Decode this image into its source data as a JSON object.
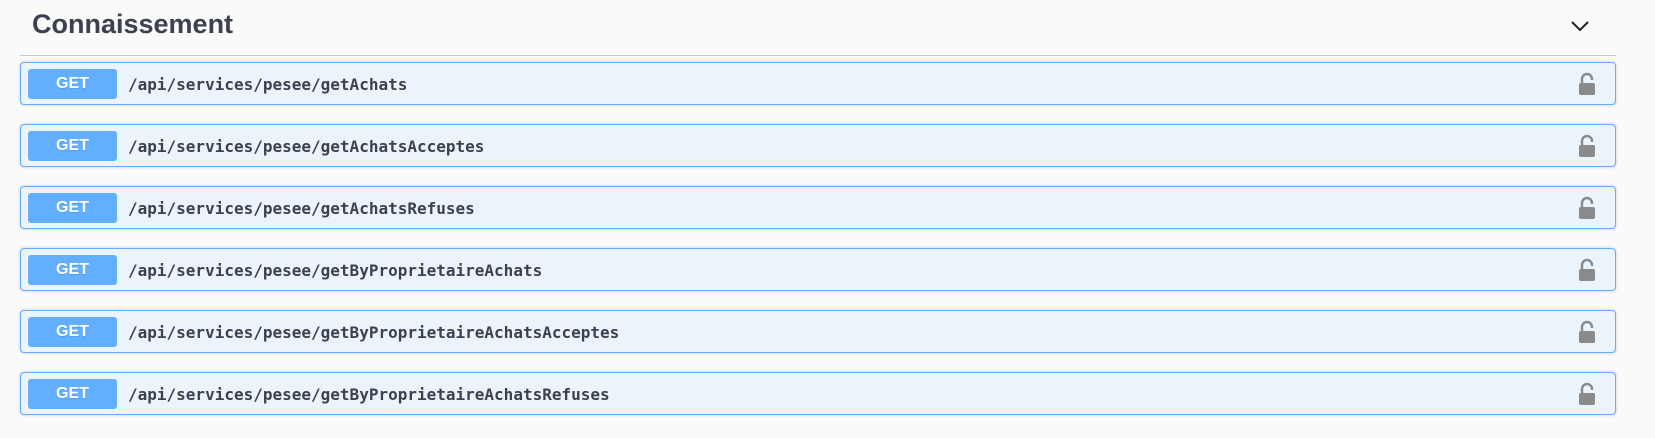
{
  "section": {
    "title": "Connaissement",
    "expand_icon": "chevron-down-icon"
  },
  "operations": [
    {
      "method": "GET",
      "path": "/api/services/pesee/getAchats",
      "lock_icon": "unlocked-padlock-icon"
    },
    {
      "method": "GET",
      "path": "/api/services/pesee/getAchatsAcceptes",
      "lock_icon": "unlocked-padlock-icon"
    },
    {
      "method": "GET",
      "path": "/api/services/pesee/getAchatsRefuses",
      "lock_icon": "unlocked-padlock-icon"
    },
    {
      "method": "GET",
      "path": "/api/services/pesee/getByProprietaireAchats",
      "lock_icon": "unlocked-padlock-icon"
    },
    {
      "method": "GET",
      "path": "/api/services/pesee/getByProprietaireAchatsAcceptes",
      "lock_icon": "unlocked-padlock-icon"
    },
    {
      "method": "GET",
      "path": "/api/services/pesee/getByProprietaireAchatsRefuses",
      "lock_icon": "unlocked-padlock-icon"
    }
  ],
  "colors": {
    "get_accent": "#61affe",
    "get_background": "#ebf3fb",
    "title_text": "#3b4151",
    "lock_icon": "#8a8a8a"
  }
}
